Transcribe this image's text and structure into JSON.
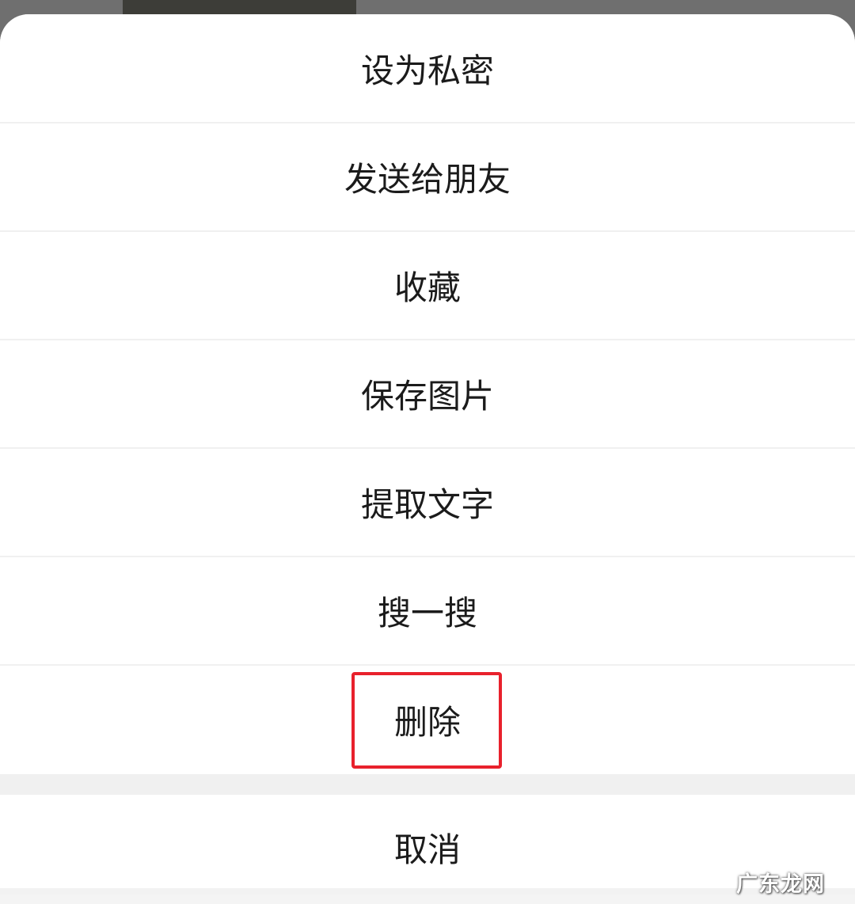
{
  "action_sheet": {
    "items": [
      {
        "label": "设为私密"
      },
      {
        "label": "发送给朋友"
      },
      {
        "label": "收藏"
      },
      {
        "label": "保存图片"
      },
      {
        "label": "提取文字"
      },
      {
        "label": "搜一搜"
      },
      {
        "label": "删除"
      }
    ],
    "cancel_label": "取消"
  },
  "highlight": {
    "target": "删除",
    "color": "#e8212c"
  },
  "watermark": {
    "text": "广东龙网"
  }
}
